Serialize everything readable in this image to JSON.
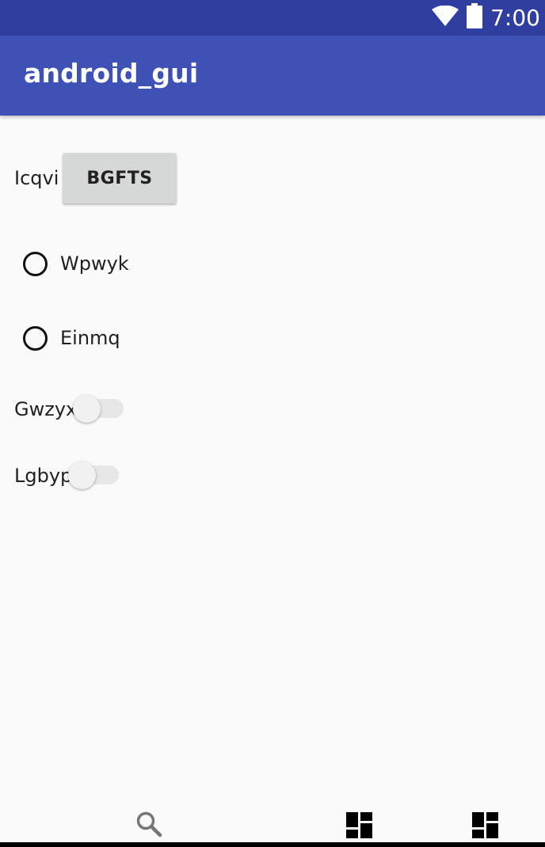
{
  "status_bar": {
    "time": "7:00",
    "icons": [
      "wifi-icon",
      "battery-icon"
    ]
  },
  "app_bar": {
    "title": "android_gui"
  },
  "form": {
    "label_row": {
      "label": "Icqvi",
      "button_label": "BGFTS"
    },
    "radios": [
      {
        "label": "Wpwyk",
        "checked": false
      },
      {
        "label": "Einmq",
        "checked": false
      }
    ],
    "switches": [
      {
        "label": "Gwzyx",
        "on": false
      },
      {
        "label": "Lgbyp",
        "on": false
      }
    ]
  },
  "bottom_nav": {
    "icons": [
      "search-icon",
      "dashboard-icon",
      "dashboard-icon"
    ]
  },
  "colors": {
    "status_bar": "#303f9f",
    "app_bar": "#3f51b5",
    "background": "#fafafa"
  }
}
